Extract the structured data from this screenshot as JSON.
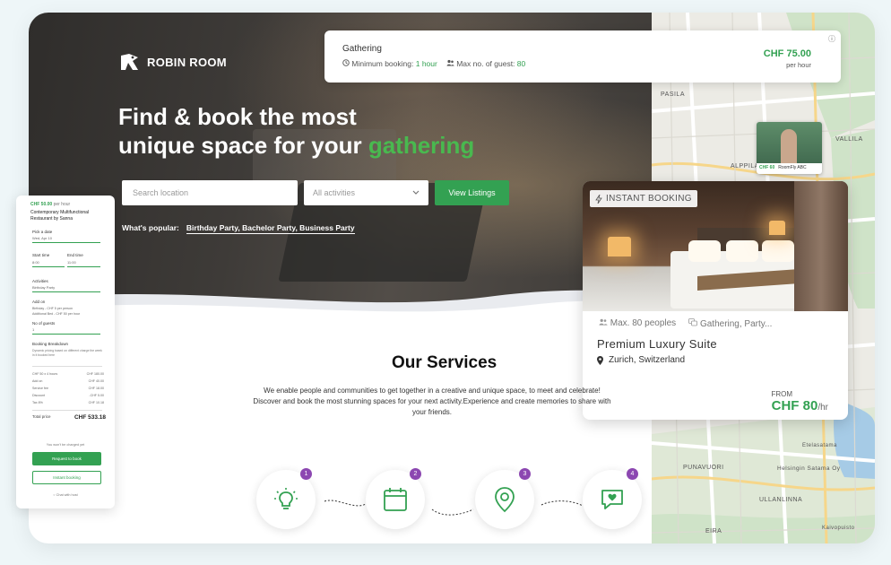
{
  "brand": {
    "name": "ROBIN ROOM"
  },
  "hero": {
    "headline_line1": "Find & book the most",
    "headline_line2_prefix": "unique space for your",
    "headline_accent": "gathering",
    "search_placeholder": "Search location",
    "activity_placeholder": "All activities",
    "view_button": "View Listings",
    "popular_label": "What's popular:",
    "popular_items": "Birthday Party, Bachelor Party, Business Party"
  },
  "gathering_card": {
    "title": "Gathering",
    "min_booking_label": "Minimum booking:",
    "min_booking_value": "1 hour",
    "max_guest_label": "Max no. of guest:",
    "max_guest_value": "80",
    "price": "CHF 75.00",
    "price_unit": "per hour"
  },
  "map": {
    "labels": [
      "PASILA",
      "VALLILA",
      "ALPPILA",
      "PUNAVUORI",
      "ULLANLINNA",
      "EIRA",
      "Helsingin Satama Oy",
      "Etelasatama",
      "Kaivopuisto"
    ],
    "thumb_price": "CHF 60",
    "thumb_name": "RoomFly ABC"
  },
  "listing": {
    "badge": "INSTANT BOOKING",
    "capacity": "Max. 80 peoples",
    "category": "Gathering, Party...",
    "title": "Premium Luxury Suite",
    "location": "Zurich, Switzerland",
    "from_label": "FROM",
    "price": "CHF 80",
    "price_unit": "/hr"
  },
  "services": {
    "title": "Our Services",
    "text": "We enable people and communities to get together in a creative and unique space, to meet and celebrate! Discover and book the most stunning spaces for your next activity.Experience and create memories to share with your friends.",
    "steps": [
      "1",
      "2",
      "3",
      "4"
    ]
  },
  "booking_panel": {
    "price": "CHF 50.00",
    "price_unit": "per hour",
    "venue": "Contemporary Multifunctional Restaurant by Sanna",
    "date_label": "Pick a date",
    "date_value": "Wed, Apr 10",
    "start_label": "Start time",
    "start_value": "8:00",
    "end_label": "End time",
    "end_value": "11:00",
    "activities_label": "Activities",
    "activities_value": "Birthday Party",
    "addon_label": "Add on",
    "addon_1": "Birthday - CHF 5 per person",
    "addon_2": "Additional Bed - CHF 50 per hour",
    "guests_label": "No of guests",
    "guests_value": "1",
    "breakdown_label": "Booking Breakdown",
    "breakdown_note": "Dynamic pricing based on different charge the week in it booked here",
    "rows": [
      {
        "label": "CHF 50 x 4 hours",
        "value": "CHF 180.00"
      },
      {
        "label": "Add on",
        "value": "CHF 40.00"
      },
      {
        "label": "Service fee",
        "value": "CHF 18.00"
      },
      {
        "label": "Discount",
        "value": "-CHF 5.00"
      },
      {
        "label": "Tax 8%",
        "value": "CHF 10.18"
      }
    ],
    "total_label": "Total price",
    "total_value": "CHF 533.18",
    "note": "You won't be charged yet",
    "request_button": "Request to book",
    "instant_button": "Instant booking",
    "chat": "Chat with host"
  },
  "colors": {
    "accent": "#33a152",
    "step_badge": "#8c47b1"
  }
}
